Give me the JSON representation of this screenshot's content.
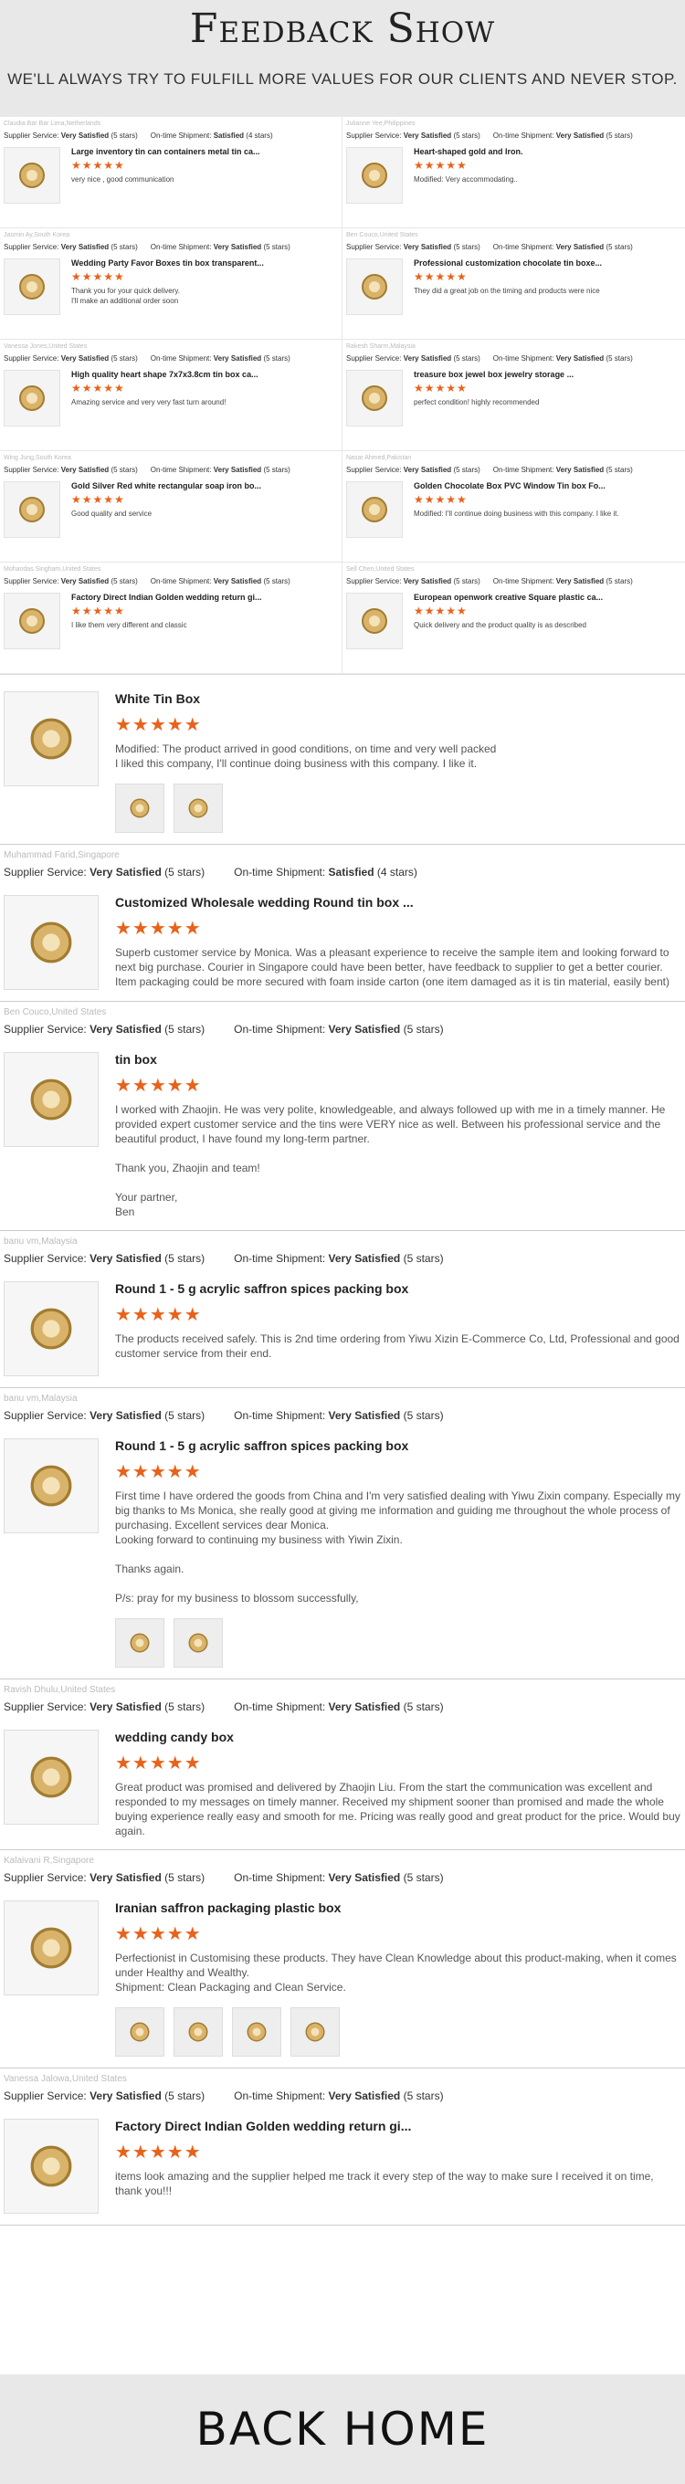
{
  "header": {
    "title": "Feedback Show",
    "subtitle": "WE'LL ALWAYS TRY TO FULFILL MORE VALUES FOR OUR CLIENTS AND NEVER STOP."
  },
  "labels": {
    "supplier": "Supplier Service:",
    "shipment": "On-time Shipment:"
  },
  "grid": [
    {
      "who": "Claudia Bar Bar Lima,Netherlands",
      "supplier": "Very Satisfied",
      "supplier_stars": "(5 stars)",
      "shipment": "Satisfied",
      "shipment_stars": "(4 stars)",
      "product": "Large inventory tin can containers metal tin ca...",
      "stars": "★★★★★",
      "feedback": "very nice , good communication",
      "icon": "pink-tin-icon"
    },
    {
      "who": "Julianne Yee,Philippines",
      "supplier": "Very Satisfied",
      "supplier_stars": "(5 stars)",
      "shipment": "Very Satisfied",
      "shipment_stars": "(5 stars)",
      "product": "Heart-shaped gold and Iron.",
      "stars": "★★★★★",
      "feedback": "Modified: Very accommodating..",
      "icon": "heart-tin-icon"
    },
    {
      "who": "Jasmin Ay,South Korea",
      "supplier": "Very Satisfied",
      "supplier_stars": "(5 stars)",
      "shipment": "Very Satisfied",
      "shipment_stars": "(5 stars)",
      "product": "Wedding Party Favor Boxes tin box transparent...",
      "stars": "★★★★★",
      "feedback": "Thank you for your quick delivery.\nI'll make an additional order soon",
      "icon": "favor-box-icon"
    },
    {
      "who": "Ben Couco,United States",
      "supplier": "Very Satisfied",
      "supplier_stars": "(5 stars)",
      "shipment": "Very Satisfied",
      "shipment_stars": "(5 stars)",
      "product": "Professional customization chocolate tin boxe...",
      "stars": "★★★★★",
      "feedback": "They did a great job on the timing and products were nice",
      "icon": "round-tin-icon"
    },
    {
      "who": "Vanessa Jones,United States",
      "supplier": "Very Satisfied",
      "supplier_stars": "(5 stars)",
      "shipment": "Very Satisfied",
      "shipment_stars": "(5 stars)",
      "product": "High quality heart shape 7x7x3.8cm tin box ca...",
      "stars": "★★★★★",
      "feedback": "Amazing service and very very fast turn around!",
      "icon": "heart-boxes-icon"
    },
    {
      "who": "Rakesh Sharm,Malaysia",
      "supplier": "Very Satisfied",
      "supplier_stars": "(5 stars)",
      "shipment": "Very Satisfied",
      "shipment_stars": "(5 stars)",
      "product": "treasure box jewel box jewelry storage ...",
      "stars": "★★★★★",
      "feedback": "perfect condition! highly recommended",
      "icon": "kraft-box-icon"
    },
    {
      "who": "Wing Jung,South Korea",
      "supplier": "Very Satisfied",
      "supplier_stars": "(5 stars)",
      "shipment": "Very Satisfied",
      "shipment_stars": "(5 stars)",
      "product": "Gold Silver Red white rectangular soap iron bo...",
      "stars": "★★★★★",
      "feedback": "Good quality and service",
      "icon": "soap-tins-icon"
    },
    {
      "who": "Nasar Ahmed,Pakistan",
      "supplier": "Very Satisfied",
      "supplier_stars": "(5 stars)",
      "shipment": "Very Satisfied",
      "shipment_stars": "(5 stars)",
      "product": "Golden Chocolate Box PVC Window Tin box Fo...",
      "stars": "★★★★★",
      "feedback": "Modified: I'll continue doing business with this company. I like it.",
      "icon": "gold-window-tin-icon"
    },
    {
      "who": "Mohandas Singham,United States",
      "supplier": "Very Satisfied",
      "supplier_stars": "(5 stars)",
      "shipment": "Very Satisfied",
      "shipment_stars": "(5 stars)",
      "product": "Factory Direct Indian Golden wedding return gi...",
      "stars": "★★★★★",
      "feedback": "I like them very different and classic",
      "icon": "golden-box-icon"
    },
    {
      "who": "Sell Chen,United States",
      "supplier": "Very Satisfied",
      "supplier_stars": "(5 stars)",
      "shipment": "Very Satisfied",
      "shipment_stars": "(5 stars)",
      "product": "European openwork creative Square plastic ca...",
      "stars": "★★★★★",
      "feedback": "Quick delivery and the product quality is as described",
      "icon": "openwork-box-icon"
    }
  ],
  "reviews": [
    {
      "who": "",
      "supplier": "",
      "supplier_stars": "",
      "shipment": "",
      "shipment_stars": "",
      "product": "White Tin Box",
      "stars": "★★★★★",
      "feedback": "Modified: The product arrived in good conditions, on time and very well packed\nI liked this company, I'll continue doing business with this company. I like it.",
      "icon": "white-tin-box-icon",
      "photos": [
        "gold-chocolate-photo",
        "red-chocolate-photo"
      ]
    },
    {
      "who": "Muhammad Farid,Singapore",
      "supplier": "Very Satisfied",
      "supplier_stars": "(5 stars)",
      "shipment": "Satisfied",
      "shipment_stars": "(4 stars)",
      "product": "Customized Wholesale wedding Round tin box ...",
      "stars": "★★★★★",
      "feedback": "Superb customer service by Monica. Was a pleasant experience to receive the sample item and looking forward to next big purchase. Courier in Singapore could have been better, have feedback to supplier to get a better courier. Item packaging could be more secured with foam inside carton (one item damaged as it is tin material, easily bent)",
      "icon": "blue-round-tin-icon",
      "photos": []
    },
    {
      "who": "Ben Couco,United States",
      "supplier": "Very Satisfied",
      "supplier_stars": "(5 stars)",
      "shipment": "Very Satisfied",
      "shipment_stars": "(5 stars)",
      "product": "tin box",
      "stars": "★★★★★",
      "feedback": "I worked with Zhaojin. He was very polite, knowledgeable, and always followed up with me in a timely manner. He provided expert customer service and the tins were VERY nice as well. Between his professional service and the beautiful product, I have found my long-term partner.\n\nThank you, Zhaojin and team!\n\nYour partner,\nBen",
      "icon": "square-tin-icon",
      "photos": []
    },
    {
      "who": "banu vm,Malaysia",
      "supplier": "Very Satisfied",
      "supplier_stars": "(5 stars)",
      "shipment": "Very Satisfied",
      "shipment_stars": "(5 stars)",
      "product": "Round 1 - 5 g acrylic saffron spices packing box",
      "stars": "★★★★★",
      "feedback": "The products received safely. This is 2nd time ordering from Yiwu Xizin E-Commerce Co, Ltd, Professional and good customer service from their end.",
      "icon": "saffron-box-icon",
      "photos": []
    },
    {
      "who": "banu vm,Malaysia",
      "supplier": "Very Satisfied",
      "supplier_stars": "(5 stars)",
      "shipment": "Very Satisfied",
      "shipment_stars": "(5 stars)",
      "product": "Round 1 - 5 g acrylic saffron spices packing box",
      "stars": "★★★★★",
      "feedback": "First time I have ordered the goods from China and I'm very satisfied dealing with Yiwu Zixin company. Especially my big thanks to Ms Monica, she really good at giving me information and guiding me throughout the whole process of purchasing. Excellent services dear Monica.\nLooking forward to continuing my business with Yiwin Zixin.\n\nThanks again.\n\nP/s: pray for my business to blossom successfully,",
      "icon": "saffron-box-icon",
      "photos": [
        "saffron-photo-1",
        "saffron-photo-2"
      ]
    },
    {
      "who": "Ravish Dhulu,United States",
      "supplier": "Very Satisfied",
      "supplier_stars": "(5 stars)",
      "shipment": "Very Satisfied",
      "shipment_stars": "(5 stars)",
      "product": "wedding candy box",
      "stars": "★★★★★",
      "feedback": "Great product was promised and delivered by Zhaojin Liu. From the start the communication was excellent and responded to my messages on timely manner. Received my shipment sooner than promised and made the whole buying experience really easy and smooth for me. Pricing was really good and great product for the price. Would buy again.",
      "icon": "candy-box-icon",
      "photos": []
    },
    {
      "who": "Kalaivani R,Singapore",
      "supplier": "Very Satisfied",
      "supplier_stars": "(5 stars)",
      "shipment": "Very Satisfied",
      "shipment_stars": "(5 stars)",
      "product": "Iranian saffron packaging plastic box",
      "stars": "★★★★★",
      "feedback": "Perfectionist in Customising these products. They have Clean Knowledge about this product-making, when it comes under Healthy and Wealthy.\nShipment: Clean Packaging and Clean Service.",
      "icon": "purple-box-icon",
      "photos": [
        "iranian-photo-1",
        "iranian-photo-2",
        "iranian-photo-3",
        "iranian-photo-4"
      ]
    },
    {
      "who": "Vanessa Jalowa,United States",
      "supplier": "Very Satisfied",
      "supplier_stars": "(5 stars)",
      "shipment": "Very Satisfied",
      "shipment_stars": "(5 stars)",
      "product": "Factory Direct Indian Golden wedding return gi...",
      "stars": "★★★★★",
      "feedback": "items look amazing and the supplier helped me track it every step of the way to make sure I received it on time, thank you!!!",
      "icon": "golden-box-icon",
      "photos": []
    }
  ],
  "footer": {
    "label": "BACK HOME"
  },
  "colors": {
    "star": "#e8621a",
    "header_bg": "#e8e8e8"
  }
}
